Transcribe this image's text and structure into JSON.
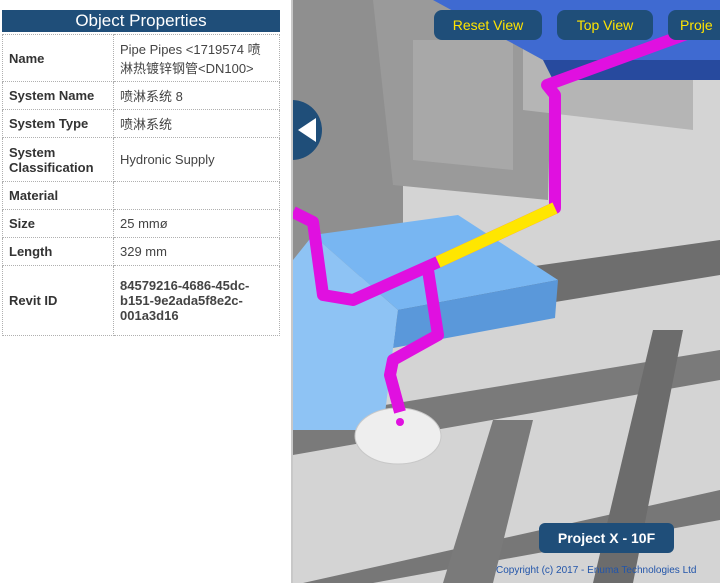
{
  "panel": {
    "title": "Object Properties",
    "rows": [
      {
        "key": "Name",
        "value": "Pipe Pipes <1719574 喷淋热镀锌钢管<DN100>"
      },
      {
        "key": "System Name",
        "value": "喷淋系统 8"
      },
      {
        "key": "System Type",
        "value": "喷淋系统"
      },
      {
        "key": "System Classification",
        "value": "Hydronic Supply"
      },
      {
        "key": "Material",
        "value": ""
      },
      {
        "key": "Size",
        "value": "25 mmø"
      },
      {
        "key": "Length",
        "value": "329 mm"
      },
      {
        "key": "Revit ID",
        "value": "84579216-4686-45dc-b151-9e2ada5f8e2c-001a3d16"
      }
    ]
  },
  "viewport": {
    "buttons": {
      "reset": "Reset View",
      "top": "Top View",
      "project": "Proje"
    },
    "project_label": "Project X - 10F",
    "copyright": "Copyright (c) 2017 - Enuma Technologies Ltd"
  },
  "icons": {
    "collapse": "chevron-left-icon"
  },
  "colors": {
    "accent": "#1f4e79",
    "button_text": "#ffe400",
    "pipe": "#e010e0",
    "pipe_selected": "#ffe600"
  }
}
